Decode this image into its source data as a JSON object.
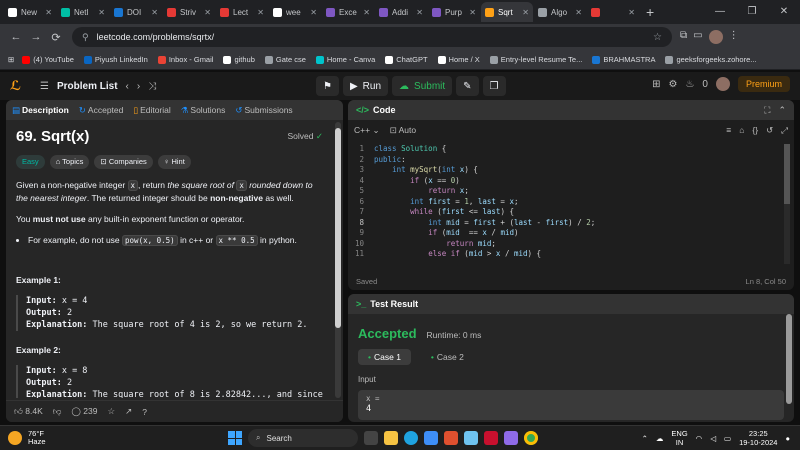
{
  "browser": {
    "tabs": [
      {
        "label": "New",
        "color": "#ffffff"
      },
      {
        "label": "Netl",
        "color": "#00bfa5"
      },
      {
        "label": "DOI",
        "color": "#1976d2"
      },
      {
        "label": "Striv",
        "color": "#e53935"
      },
      {
        "label": "Lect",
        "color": "#e53935"
      },
      {
        "label": "wee",
        "color": "#ffffff"
      },
      {
        "label": "Exce",
        "color": "#7e57c2"
      },
      {
        "label": "Addi",
        "color": "#7e57c2"
      },
      {
        "label": "Purp",
        "color": "#7e57c2"
      },
      {
        "label": "Sqrt",
        "color": "#ffa116",
        "active": true
      },
      {
        "label": "Algo",
        "color": "#9aa0a6"
      },
      {
        "label": "",
        "color": "#e53935"
      }
    ],
    "url": "leetcode.com/problems/sqrtx/",
    "bookmarks": [
      {
        "label": "(4) YouTube",
        "color": "#ff0000"
      },
      {
        "label": "Piyush LinkedIn",
        "color": "#0a66c2"
      },
      {
        "label": "Inbox - Gmail",
        "color": "#ea4335"
      },
      {
        "label": "github",
        "color": "#ffffff"
      },
      {
        "label": "Gate cse",
        "color": "#9aa0a6"
      },
      {
        "label": "Home - Canva",
        "color": "#00c4cc"
      },
      {
        "label": "ChatGPT",
        "color": "#ffffff"
      },
      {
        "label": "Home / X",
        "color": "#ffffff"
      },
      {
        "label": "Entry-level Resume Te...",
        "color": "#9aa0a6"
      },
      {
        "label": "BRAHMASTRA",
        "color": "#1976d2"
      },
      {
        "label": "geeksforgeeks.zohore...",
        "color": "#9aa0a6"
      }
    ]
  },
  "header": {
    "problem_list": "Problem List",
    "run": "Run",
    "submit": "Submit",
    "streak": "0",
    "premium": "Premium"
  },
  "problem": {
    "tabs": [
      "Description",
      "Accepted",
      "Editorial",
      "Solutions",
      "Submissions"
    ],
    "title": "69. Sqrt(x)",
    "status": "Solved",
    "badges": [
      "Easy",
      "Topics",
      "Companies",
      "Hint"
    ],
    "desc1_a": "Given a non-negative integer ",
    "desc1_code": "x",
    "desc1_b": ", return ",
    "desc1_c": "the square root of ",
    "desc1_code2": "x",
    "desc1_d": " rounded down to the nearest integer",
    "desc1_e": ". The returned integer should be ",
    "desc1_f": "non-negative",
    "desc1_g": " as well.",
    "desc2_a": "You ",
    "desc2_b": "must not use",
    "desc2_c": " any built-in exponent function or operator.",
    "bullet_a": "For example, do not use ",
    "bullet_code1": "pow(x, 0.5)",
    "bullet_b": " in c++ or ",
    "bullet_code2": "x ** 0.5",
    "bullet_c": " in python.",
    "ex1_title": "Example 1:",
    "ex1_input_label": "Input:",
    "ex1_input": " x = 4",
    "ex1_output_label": "Output:",
    "ex1_output": " 2",
    "ex1_expl_label": "Explanation:",
    "ex1_expl": " The square root of 4 is 2, so we return 2.",
    "ex2_title": "Example 2:",
    "ex2_input_label": "Input:",
    "ex2_input": " x = 8",
    "ex2_output_label": "Output:",
    "ex2_output": " 2",
    "ex2_expl_label": "Explanation:",
    "ex2_expl": " The square root of 8 is 2.82842..., and since",
    "likes": "8.4K",
    "comments": "239"
  },
  "code": {
    "title": "Code",
    "language": "C++",
    "mode": "Auto",
    "saved": "Saved",
    "cursor": "Ln 8, Col 50",
    "current_line": 8
  },
  "test": {
    "title": "Test Result",
    "status": "Accepted",
    "runtime": "Runtime: 0 ms",
    "case1": "Case 1",
    "case2": "Case 2",
    "input_label": "Input",
    "var_label": "x =",
    "var_value": "4"
  },
  "taskbar": {
    "temp": "76°F",
    "weather": "Haze",
    "search": "Search",
    "lang1": "ENG",
    "lang2": "IN",
    "time": "23:25",
    "date": "19-10-2024"
  }
}
